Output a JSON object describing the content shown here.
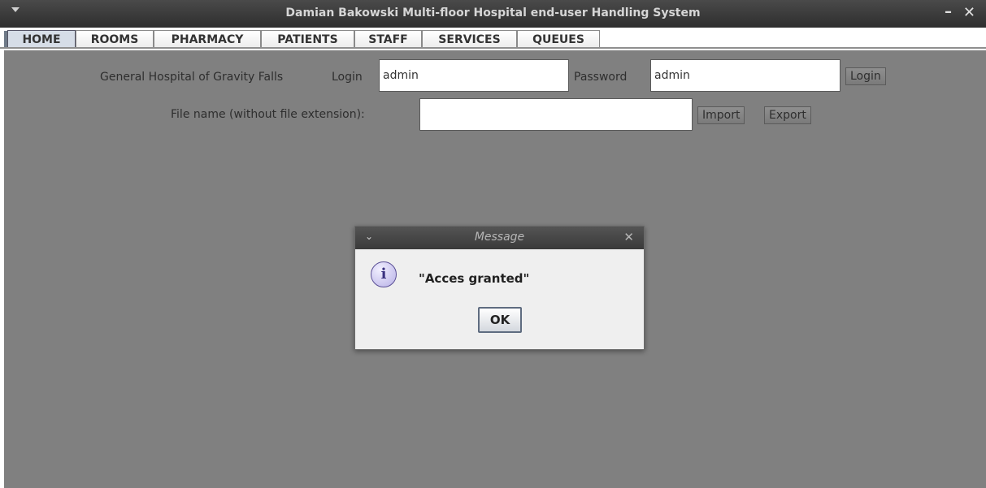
{
  "window": {
    "title": "Damian Bakowski Multi-floor Hospital end-user Handling System",
    "minimize": "–",
    "close": "✕"
  },
  "tabs": [
    "HOME",
    "ROOMS",
    "PHARMACY",
    "PATIENTS",
    "STAFF",
    "SERVICES",
    "QUEUES"
  ],
  "home": {
    "hospital_name": "General Hospital of Gravity Falls",
    "login_label": "Login",
    "login_value": "admin",
    "password_label": "Password",
    "password_value": "admin",
    "login_button": "Login",
    "file_label": "File name (without file extension):",
    "file_value": "",
    "import_button": "Import",
    "export_button": "Export"
  },
  "dialog": {
    "title": "Message",
    "message": "\"Acces granted\"",
    "ok_button": "OK",
    "close": "✕",
    "menu": "⌄",
    "icon": "info-icon"
  }
}
